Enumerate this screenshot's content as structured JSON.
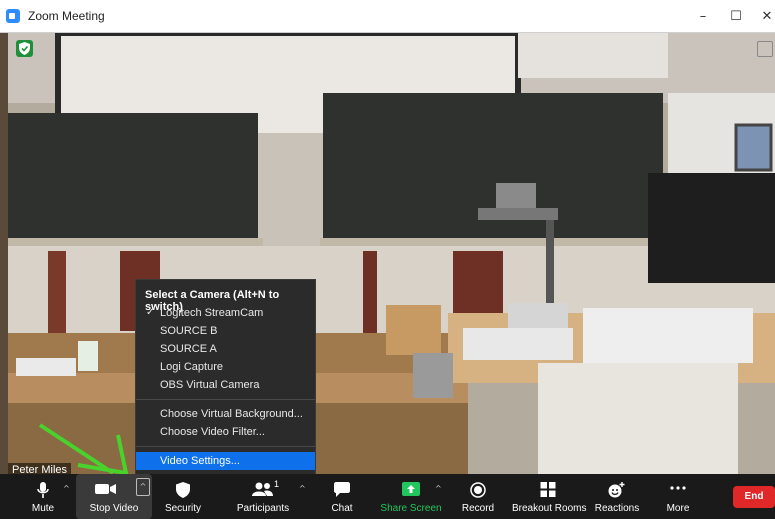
{
  "window": {
    "title": "Zoom Meeting",
    "minimize": "–",
    "maximize": "☐",
    "close": "✕"
  },
  "participant": {
    "name": "Peter Miles"
  },
  "camera_menu": {
    "header": "Select a Camera (Alt+N to switch)",
    "cameras": [
      "Logitech StreamCam",
      "SOURCE B",
      "SOURCE A",
      "Logi Capture",
      "OBS Virtual Camera"
    ],
    "selected_camera": "Logitech StreamCam",
    "check_glyph": "✓",
    "actions": [
      "Choose Virtual Background...",
      "Choose Video Filter..."
    ],
    "settings": "Video Settings..."
  },
  "toolbar": {
    "mute": "Mute",
    "stop_video": "Stop Video",
    "security": "Security",
    "participants": "Participants",
    "participants_count": "1",
    "chat": "Chat",
    "share_screen": "Share Screen",
    "record": "Record",
    "breakout_rooms": "Breakout Rooms",
    "reactions": "Reactions",
    "more": "More",
    "end": "End"
  },
  "colors": {
    "accent": "#0e71eb",
    "share": "#22c55e",
    "end": "#e02828",
    "shield": "#1f8f3a"
  }
}
